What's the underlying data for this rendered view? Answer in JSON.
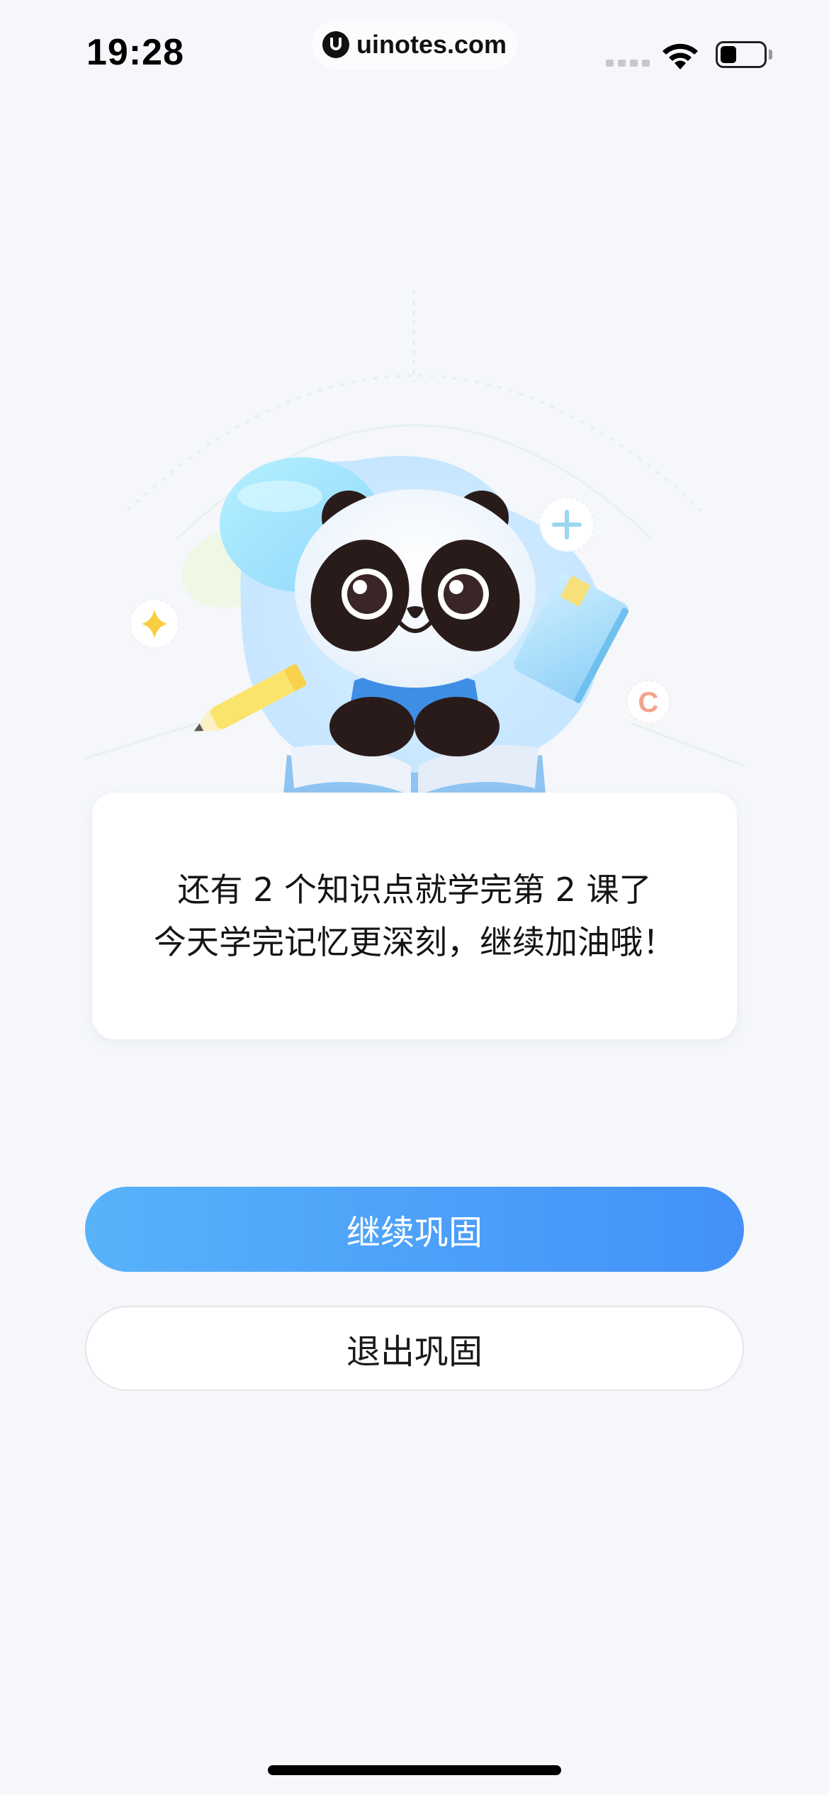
{
  "status_bar": {
    "time": "19:28",
    "watermark": "uinotes.com"
  },
  "message": {
    "line1": "还有 2 个知识点就学完第 2 课了",
    "line2": "今天学完记忆更深刻，继续加油哦！"
  },
  "buttons": {
    "continue_label": "继续巩固",
    "exit_label": "退出巩固"
  },
  "illustration": {
    "decor_letter": "C"
  },
  "colors": {
    "primary_gradient_start": "#58b2fa",
    "primary_gradient_end": "#4391f8",
    "background": "#f5f7fa"
  }
}
